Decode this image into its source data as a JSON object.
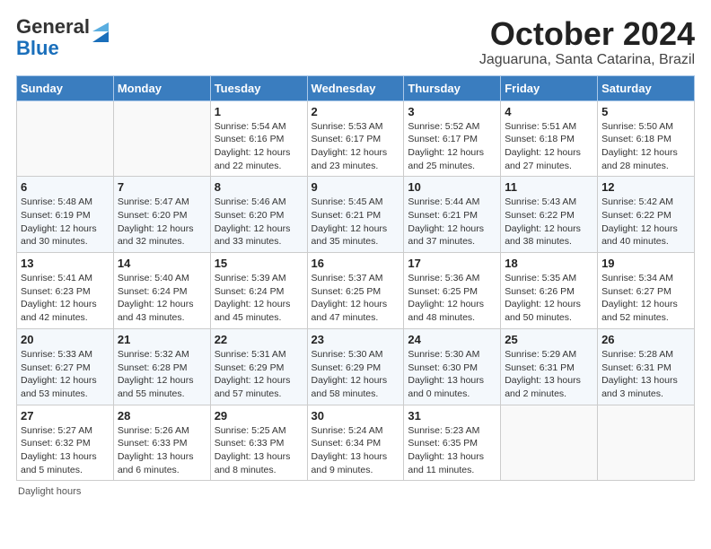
{
  "logo": {
    "general": "General",
    "blue": "Blue"
  },
  "title": "October 2024",
  "subtitle": "Jaguaruna, Santa Catarina, Brazil",
  "days_of_week": [
    "Sunday",
    "Monday",
    "Tuesday",
    "Wednesday",
    "Thursday",
    "Friday",
    "Saturday"
  ],
  "footer": "Daylight hours",
  "weeks": [
    [
      {
        "day": "",
        "info": ""
      },
      {
        "day": "",
        "info": ""
      },
      {
        "day": "1",
        "info": "Sunrise: 5:54 AM\nSunset: 6:16 PM\nDaylight: 12 hours and 22 minutes."
      },
      {
        "day": "2",
        "info": "Sunrise: 5:53 AM\nSunset: 6:17 PM\nDaylight: 12 hours and 23 minutes."
      },
      {
        "day": "3",
        "info": "Sunrise: 5:52 AM\nSunset: 6:17 PM\nDaylight: 12 hours and 25 minutes."
      },
      {
        "day": "4",
        "info": "Sunrise: 5:51 AM\nSunset: 6:18 PM\nDaylight: 12 hours and 27 minutes."
      },
      {
        "day": "5",
        "info": "Sunrise: 5:50 AM\nSunset: 6:18 PM\nDaylight: 12 hours and 28 minutes."
      }
    ],
    [
      {
        "day": "6",
        "info": "Sunrise: 5:48 AM\nSunset: 6:19 PM\nDaylight: 12 hours and 30 minutes."
      },
      {
        "day": "7",
        "info": "Sunrise: 5:47 AM\nSunset: 6:20 PM\nDaylight: 12 hours and 32 minutes."
      },
      {
        "day": "8",
        "info": "Sunrise: 5:46 AM\nSunset: 6:20 PM\nDaylight: 12 hours and 33 minutes."
      },
      {
        "day": "9",
        "info": "Sunrise: 5:45 AM\nSunset: 6:21 PM\nDaylight: 12 hours and 35 minutes."
      },
      {
        "day": "10",
        "info": "Sunrise: 5:44 AM\nSunset: 6:21 PM\nDaylight: 12 hours and 37 minutes."
      },
      {
        "day": "11",
        "info": "Sunrise: 5:43 AM\nSunset: 6:22 PM\nDaylight: 12 hours and 38 minutes."
      },
      {
        "day": "12",
        "info": "Sunrise: 5:42 AM\nSunset: 6:22 PM\nDaylight: 12 hours and 40 minutes."
      }
    ],
    [
      {
        "day": "13",
        "info": "Sunrise: 5:41 AM\nSunset: 6:23 PM\nDaylight: 12 hours and 42 minutes."
      },
      {
        "day": "14",
        "info": "Sunrise: 5:40 AM\nSunset: 6:24 PM\nDaylight: 12 hours and 43 minutes."
      },
      {
        "day": "15",
        "info": "Sunrise: 5:39 AM\nSunset: 6:24 PM\nDaylight: 12 hours and 45 minutes."
      },
      {
        "day": "16",
        "info": "Sunrise: 5:37 AM\nSunset: 6:25 PM\nDaylight: 12 hours and 47 minutes."
      },
      {
        "day": "17",
        "info": "Sunrise: 5:36 AM\nSunset: 6:25 PM\nDaylight: 12 hours and 48 minutes."
      },
      {
        "day": "18",
        "info": "Sunrise: 5:35 AM\nSunset: 6:26 PM\nDaylight: 12 hours and 50 minutes."
      },
      {
        "day": "19",
        "info": "Sunrise: 5:34 AM\nSunset: 6:27 PM\nDaylight: 12 hours and 52 minutes."
      }
    ],
    [
      {
        "day": "20",
        "info": "Sunrise: 5:33 AM\nSunset: 6:27 PM\nDaylight: 12 hours and 53 minutes."
      },
      {
        "day": "21",
        "info": "Sunrise: 5:32 AM\nSunset: 6:28 PM\nDaylight: 12 hours and 55 minutes."
      },
      {
        "day": "22",
        "info": "Sunrise: 5:31 AM\nSunset: 6:29 PM\nDaylight: 12 hours and 57 minutes."
      },
      {
        "day": "23",
        "info": "Sunrise: 5:30 AM\nSunset: 6:29 PM\nDaylight: 12 hours and 58 minutes."
      },
      {
        "day": "24",
        "info": "Sunrise: 5:30 AM\nSunset: 6:30 PM\nDaylight: 13 hours and 0 minutes."
      },
      {
        "day": "25",
        "info": "Sunrise: 5:29 AM\nSunset: 6:31 PM\nDaylight: 13 hours and 2 minutes."
      },
      {
        "day": "26",
        "info": "Sunrise: 5:28 AM\nSunset: 6:31 PM\nDaylight: 13 hours and 3 minutes."
      }
    ],
    [
      {
        "day": "27",
        "info": "Sunrise: 5:27 AM\nSunset: 6:32 PM\nDaylight: 13 hours and 5 minutes."
      },
      {
        "day": "28",
        "info": "Sunrise: 5:26 AM\nSunset: 6:33 PM\nDaylight: 13 hours and 6 minutes."
      },
      {
        "day": "29",
        "info": "Sunrise: 5:25 AM\nSunset: 6:33 PM\nDaylight: 13 hours and 8 minutes."
      },
      {
        "day": "30",
        "info": "Sunrise: 5:24 AM\nSunset: 6:34 PM\nDaylight: 13 hours and 9 minutes."
      },
      {
        "day": "31",
        "info": "Sunrise: 5:23 AM\nSunset: 6:35 PM\nDaylight: 13 hours and 11 minutes."
      },
      {
        "day": "",
        "info": ""
      },
      {
        "day": "",
        "info": ""
      }
    ]
  ]
}
